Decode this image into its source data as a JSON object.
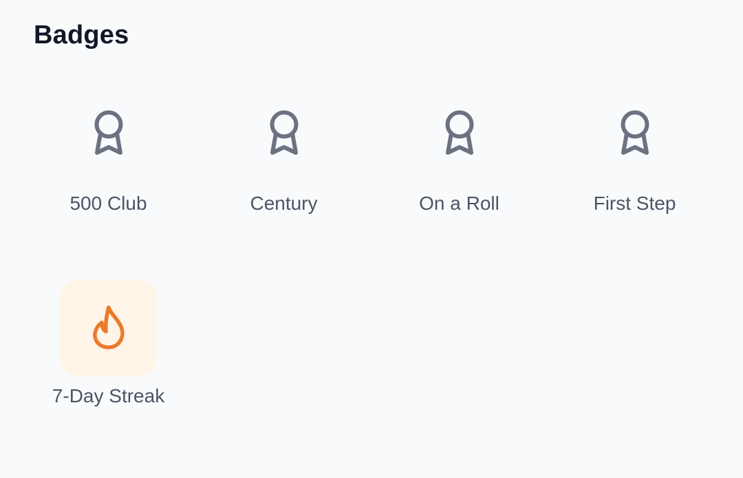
{
  "header": {
    "title": "Badges"
  },
  "badges": [
    {
      "label": "500 Club",
      "icon": "award-ribbon-icon",
      "earned": false
    },
    {
      "label": "Century",
      "icon": "award-ribbon-icon",
      "earned": false
    },
    {
      "label": "On a Roll",
      "icon": "award-ribbon-icon",
      "earned": false
    },
    {
      "label": "First Step",
      "icon": "award-ribbon-icon",
      "earned": false
    },
    {
      "label": "7-Day Streak",
      "icon": "flame-icon",
      "earned": true
    }
  ],
  "colors": {
    "background": "#f8fafc",
    "title": "#111827",
    "label": "#4b5563",
    "locked_icon": "#6b7280",
    "earned_icon": "#ea7a2a",
    "earned_tile": "#fff4e8"
  }
}
